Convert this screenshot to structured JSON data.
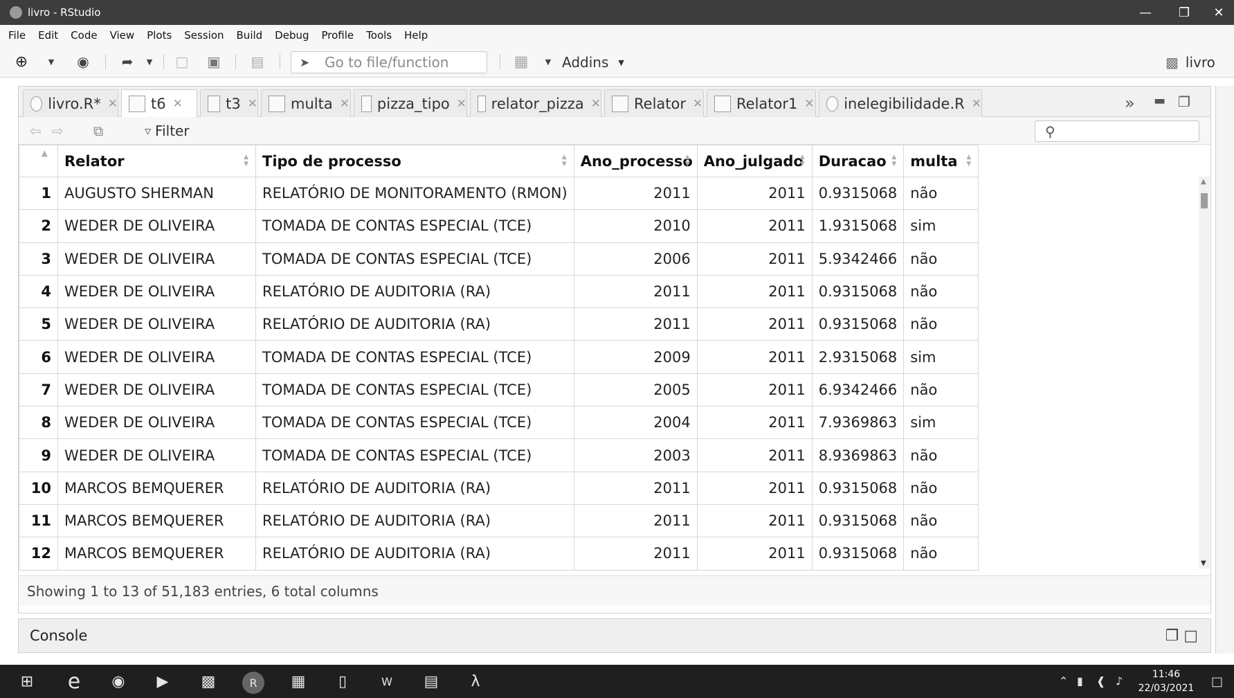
{
  "window": {
    "title": "livro - RStudio"
  },
  "menu": [
    "File",
    "Edit",
    "Code",
    "View",
    "Plots",
    "Session",
    "Build",
    "Debug",
    "Profile",
    "Tools",
    "Help"
  ],
  "toolbar": {
    "goto_placeholder": "Go to file/function",
    "addins": "Addins",
    "project": "livro"
  },
  "tabs": [
    {
      "label": "livro.R*",
      "kind": "script",
      "active": false
    },
    {
      "label": "t6",
      "kind": "data",
      "active": true
    },
    {
      "label": "t3",
      "kind": "data",
      "active": false
    },
    {
      "label": "multa",
      "kind": "data",
      "active": false
    },
    {
      "label": "pizza_tipo",
      "kind": "data",
      "active": false
    },
    {
      "label": "relator_pizza",
      "kind": "data",
      "active": false
    },
    {
      "label": "Relator",
      "kind": "data",
      "active": false
    },
    {
      "label": "Relator1",
      "kind": "data",
      "active": false
    },
    {
      "label": "inelegibilidade.R",
      "kind": "script",
      "active": false
    }
  ],
  "viewer": {
    "filter_label": "Filter",
    "columns": [
      "Relator",
      "Tipo de processo",
      "Ano_processo",
      "Ano_julgado",
      "Duracao",
      "multa"
    ],
    "rows": [
      [
        "1",
        "AUGUSTO SHERMAN",
        "RELATÓRIO DE MONITORAMENTO (RMON)",
        "2011",
        "2011",
        "0.9315068",
        "não"
      ],
      [
        "2",
        "WEDER DE OLIVEIRA",
        "TOMADA DE CONTAS ESPECIAL (TCE)",
        "2010",
        "2011",
        "1.9315068",
        "sim"
      ],
      [
        "3",
        "WEDER DE OLIVEIRA",
        "TOMADA DE CONTAS ESPECIAL (TCE)",
        "2006",
        "2011",
        "5.9342466",
        "não"
      ],
      [
        "4",
        "WEDER DE OLIVEIRA",
        "RELATÓRIO DE AUDITORIA (RA)",
        "2011",
        "2011",
        "0.9315068",
        "não"
      ],
      [
        "5",
        "WEDER DE OLIVEIRA",
        "RELATÓRIO DE AUDITORIA (RA)",
        "2011",
        "2011",
        "0.9315068",
        "não"
      ],
      [
        "6",
        "WEDER DE OLIVEIRA",
        "TOMADA DE CONTAS ESPECIAL (TCE)",
        "2009",
        "2011",
        "2.9315068",
        "sim"
      ],
      [
        "7",
        "WEDER DE OLIVEIRA",
        "TOMADA DE CONTAS ESPECIAL (TCE)",
        "2005",
        "2011",
        "6.9342466",
        "não"
      ],
      [
        "8",
        "WEDER DE OLIVEIRA",
        "TOMADA DE CONTAS ESPECIAL (TCE)",
        "2004",
        "2011",
        "7.9369863",
        "sim"
      ],
      [
        "9",
        "WEDER DE OLIVEIRA",
        "TOMADA DE CONTAS ESPECIAL (TCE)",
        "2003",
        "2011",
        "8.9369863",
        "não"
      ],
      [
        "10",
        "MARCOS BEMQUERER",
        "RELATÓRIO DE AUDITORIA (RA)",
        "2011",
        "2011",
        "0.9315068",
        "não"
      ],
      [
        "11",
        "MARCOS BEMQUERER",
        "RELATÓRIO DE AUDITORIA (RA)",
        "2011",
        "2011",
        "0.9315068",
        "não"
      ],
      [
        "12",
        "MARCOS BEMQUERER",
        "RELATÓRIO DE AUDITORIA (RA)",
        "2011",
        "2011",
        "0.9315068",
        "não"
      ]
    ],
    "status": "Showing 1 to 13 of 51,183 entries, 6 total columns"
  },
  "console": {
    "label": "Console"
  },
  "taskbar": {
    "time": "11:46",
    "date": "22/03/2021"
  }
}
